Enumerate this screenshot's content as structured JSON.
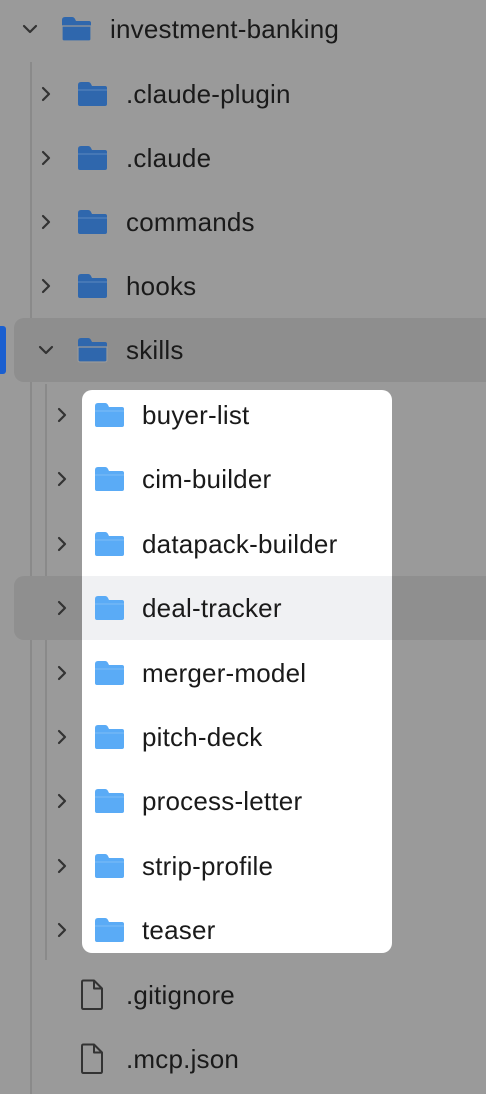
{
  "root": {
    "label": "investment-banking",
    "expanded": true
  },
  "top_items": [
    {
      "label": ".claude-plugin",
      "type": "folder",
      "expanded": false
    },
    {
      "label": ".claude",
      "type": "folder",
      "expanded": false
    },
    {
      "label": "commands",
      "type": "folder",
      "expanded": false
    },
    {
      "label": "hooks",
      "type": "folder",
      "expanded": false
    }
  ],
  "skills": {
    "label": "skills",
    "type": "folder",
    "expanded": true,
    "selected": true
  },
  "skill_items": [
    {
      "label": "buyer-list"
    },
    {
      "label": "cim-builder"
    },
    {
      "label": "datapack-builder"
    },
    {
      "label": "deal-tracker",
      "hovered": true
    },
    {
      "label": "merger-model"
    },
    {
      "label": "pitch-deck"
    },
    {
      "label": "process-letter"
    },
    {
      "label": "strip-profile"
    },
    {
      "label": "teaser"
    }
  ],
  "files": [
    {
      "label": ".gitignore",
      "type": "file"
    },
    {
      "label": ".mcp.json",
      "type": "file"
    }
  ],
  "colors": {
    "dim_folder": "#2f67ad",
    "bright_folder": "#5aabf6",
    "selection_accent": "#1a5fd0",
    "overlay": "#9a9a9a",
    "panel": "#ffffff"
  },
  "icons": {
    "collapsed": "chevron-right-icon",
    "expanded": "chevron-down-icon",
    "folder": "folder-icon",
    "file": "file-icon"
  }
}
